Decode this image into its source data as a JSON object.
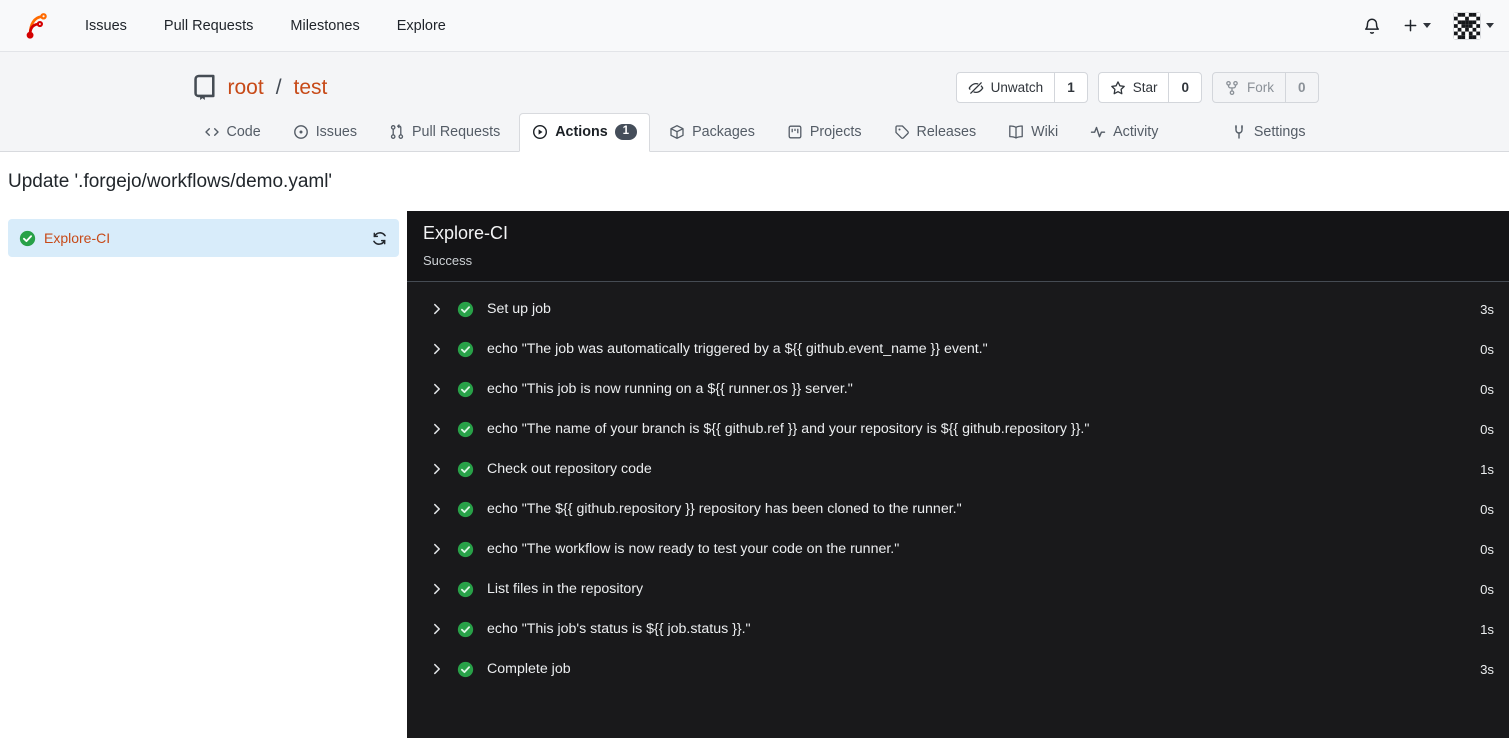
{
  "navbar": {
    "items": [
      {
        "label": "Issues"
      },
      {
        "label": "Pull Requests"
      },
      {
        "label": "Milestones"
      },
      {
        "label": "Explore"
      }
    ]
  },
  "repo_header": {
    "owner": "root",
    "separator": "/",
    "name": "test",
    "actions": [
      {
        "label": "Unwatch",
        "count": "1"
      },
      {
        "label": "Star",
        "count": "0"
      },
      {
        "label": "Fork",
        "count": "0"
      }
    ],
    "tabs": [
      {
        "label": "Code"
      },
      {
        "label": "Issues"
      },
      {
        "label": "Pull Requests"
      },
      {
        "label": "Actions",
        "badge": "1",
        "active": true
      },
      {
        "label": "Packages"
      },
      {
        "label": "Projects"
      },
      {
        "label": "Releases"
      },
      {
        "label": "Wiki"
      },
      {
        "label": "Activity"
      },
      {
        "label": "Settings"
      }
    ]
  },
  "run": {
    "title": "Update '.forgejo/workflows/demo.yaml'",
    "jobs": [
      {
        "name": "Explore-CI",
        "status": "success"
      }
    ],
    "panel": {
      "job_name": "Explore-CI",
      "status": "Success",
      "steps": [
        {
          "name": "Set up job",
          "duration": "3s"
        },
        {
          "name": "echo \"The job was automatically triggered by a ${{ github.event_name }} event.\"",
          "duration": "0s"
        },
        {
          "name": "echo \"This job is now running on a ${{ runner.os }} server.\"",
          "duration": "0s"
        },
        {
          "name": "echo \"The name of your branch is ${{ github.ref }} and your repository is ${{ github.repository }}.\"",
          "duration": "0s"
        },
        {
          "name": "Check out repository code",
          "duration": "1s"
        },
        {
          "name": "echo \"The ${{ github.repository }} repository has been cloned to the runner.\"",
          "duration": "0s"
        },
        {
          "name": "echo \"The workflow is now ready to test your code on the runner.\"",
          "duration": "0s"
        },
        {
          "name": "List files in the repository",
          "duration": "0s"
        },
        {
          "name": "echo \"This job's status is ${{ job.status }}.\"",
          "duration": "1s"
        },
        {
          "name": "Complete job",
          "duration": "3s"
        }
      ]
    }
  },
  "icons": {
    "logo": "forgejo-logo",
    "topbar": [
      "bell-icon",
      "plus-icon",
      "avatar"
    ],
    "tab_icons": [
      "code-icon",
      "issue-opened-icon",
      "git-pull-request-icon",
      "play-circle-icon",
      "package-icon",
      "project-icon",
      "tag-icon",
      "book-open-icon",
      "pulse-icon",
      "tools-icon"
    ],
    "button_icons": [
      "eye-slash-icon",
      "star-icon",
      "git-fork-icon"
    ],
    "job_icons": [
      "check-circle-icon",
      "refresh-icon"
    ],
    "step_icons": [
      "chevron-right-icon",
      "check-circle-icon"
    ]
  },
  "colors": {
    "accent_link": "#c74a18",
    "logo_orange": "#ff6b00",
    "logo_red": "#d40000",
    "success_green": "#28a148",
    "selected_job_bg": "#d8ecfa",
    "panel_bg": "#19191b",
    "badge_bg": "#454e5a",
    "header_bg": "#f4f5f7"
  }
}
